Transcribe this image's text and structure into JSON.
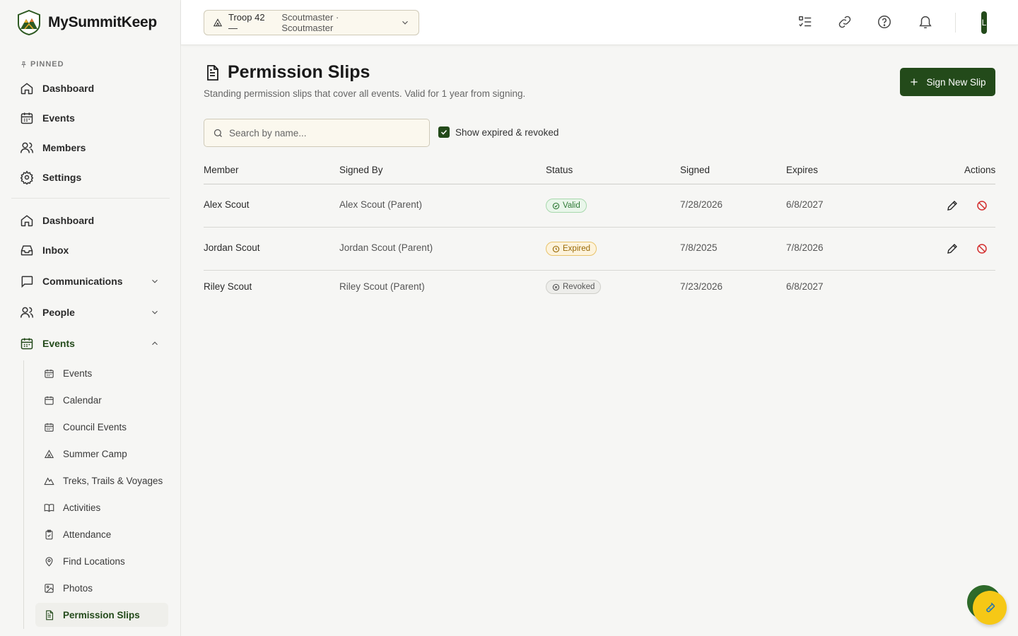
{
  "app": {
    "name": "MySummitKeep"
  },
  "sidebar": {
    "pinned_label": "PINNED",
    "pinned": [
      {
        "label": "Dashboard"
      },
      {
        "label": "Events"
      },
      {
        "label": "Members"
      },
      {
        "label": "Settings"
      }
    ],
    "main": [
      {
        "label": "Dashboard"
      },
      {
        "label": "Inbox"
      },
      {
        "label": "Communications"
      },
      {
        "label": "People"
      },
      {
        "label": "Events"
      }
    ],
    "events_sub": [
      {
        "label": "Events"
      },
      {
        "label": "Calendar"
      },
      {
        "label": "Council Events"
      },
      {
        "label": "Summer Camp"
      },
      {
        "label": "Treks, Trails & Voyages"
      },
      {
        "label": "Activities"
      },
      {
        "label": "Attendance"
      },
      {
        "label": "Find Locations"
      },
      {
        "label": "Photos"
      },
      {
        "label": "Permission Slips"
      }
    ]
  },
  "topbar": {
    "troop": "Troop 42 —",
    "role": "Scoutmaster · Scoutmaster",
    "avatar_initial": "L"
  },
  "page": {
    "title": "Permission Slips",
    "subtitle": "Standing permission slips that cover all events. Valid for 1 year from signing.",
    "new_button": "Sign New Slip",
    "search_placeholder": "Search by name...",
    "show_expired_label": "Show expired & revoked"
  },
  "table": {
    "headers": {
      "member": "Member",
      "signed_by": "Signed By",
      "status": "Status",
      "signed": "Signed",
      "expires": "Expires",
      "actions": "Actions"
    },
    "rows": [
      {
        "member": "Alex Scout",
        "signed_by": "Alex Scout (Parent)",
        "status": "Valid",
        "signed": "7/28/2026",
        "expires": "6/8/2027"
      },
      {
        "member": "Jordan Scout",
        "signed_by": "Jordan Scout (Parent)",
        "status": "Expired",
        "signed": "7/8/2025",
        "expires": "7/8/2026"
      },
      {
        "member": "Riley Scout",
        "signed_by": "Riley Scout (Parent)",
        "status": "Revoked",
        "signed": "7/23/2026",
        "expires": "6/8/2027"
      }
    ]
  },
  "colors": {
    "brand": "#234a1a",
    "valid": "#2f7a36",
    "expired": "#9a6a06",
    "revoke": "#d32f2f"
  }
}
